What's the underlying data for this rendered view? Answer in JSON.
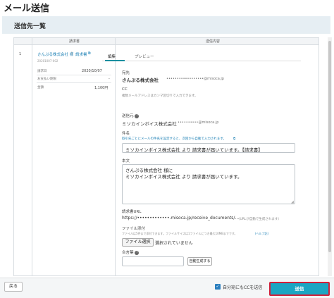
{
  "page": {
    "title": "メール送信",
    "section_title": "送信先一覧"
  },
  "table": {
    "col_invoice": "請求書",
    "col_content": "送信内容"
  },
  "row": {
    "index": "1",
    "client_name": "さんぷる株式会社 様",
    "separator": "|",
    "invoice_link": "請求書",
    "invoice_number": "20201007-002",
    "details": [
      {
        "label": "請求日",
        "value": "2020/10/07"
      },
      {
        "label": "お支払い期限",
        "value": "-"
      },
      {
        "label": "金額",
        "value": "1,100円"
      }
    ]
  },
  "tabs": [
    {
      "label": "編集",
      "active": true
    },
    {
      "label": "プレビュー",
      "active": false
    }
  ],
  "form": {
    "to_label": "宛先",
    "to_name": "さんぷる株式会社",
    "to_email": "••••••••••••••••••@misoca.jp",
    "cc_label": "CC",
    "cc_hint": "複数メールアドレスはカンマ区切りで入力できます。",
    "from_label": "送信元",
    "from_name": "ミソカインボイス株式会社",
    "from_email": "••••••••••@misoca.jp",
    "subject_label": "件名",
    "subject_hint": "取引先ごとにメールの件名を設定すると、次回から自動で入力されます。",
    "subject_value": "ミソカインボイス株式会社 より 請求書が届いています。【請求書】",
    "body_label": "本文",
    "body_line1": "さんぷる株式会社 様に",
    "body_line2": "ミソカインボイス株式会社 より 請求書が届いています。",
    "url_label": "請求書URL",
    "url_value": "https://•••••••••••••.misoca.jp/receive_documents/...",
    "url_note": "（URLが自動で生成されます）",
    "attach_label": "ファイル添付",
    "attach_hint": "ファイルは5件まで添付できます。ファイルサイズは1ファイルにつき最大10MBまでです。",
    "attach_help": "(ヘルプ記)",
    "file_button": "ファイル選択",
    "file_status": "選択されていません",
    "password_label": "合言葉",
    "auto_generate": "自動生成する"
  },
  "footer": {
    "back": "戻る",
    "cc_self": "自分宛にもCCを送信",
    "send": "送信"
  },
  "colors": {
    "accent": "#1ba6c3",
    "link": "#1a7fb4",
    "highlight_border": "#d0203a"
  }
}
